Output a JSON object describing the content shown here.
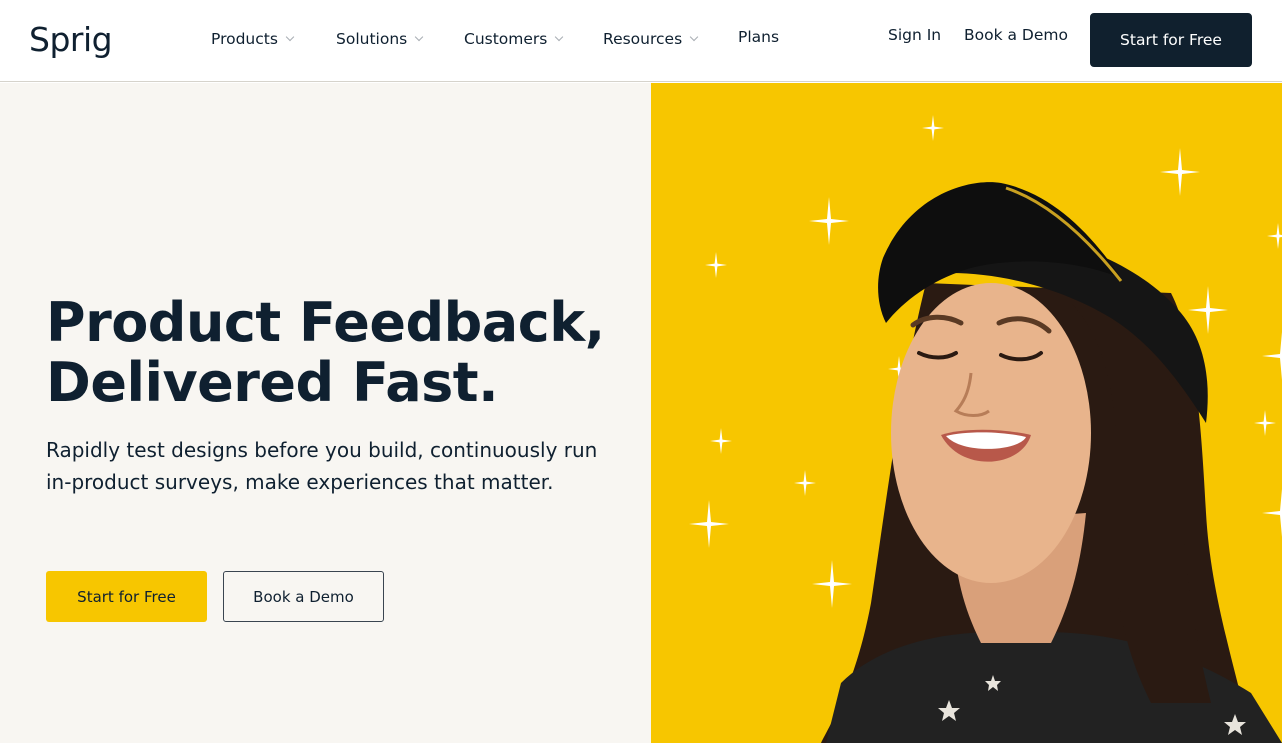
{
  "header": {
    "logo": "Sprig",
    "nav": [
      {
        "label": "Products",
        "has_dropdown": true
      },
      {
        "label": "Solutions",
        "has_dropdown": true
      },
      {
        "label": "Customers",
        "has_dropdown": true
      },
      {
        "label": "Resources",
        "has_dropdown": true
      },
      {
        "label": "Plans",
        "has_dropdown": false
      }
    ],
    "sign_in": "Sign In",
    "book_demo": "Book a Demo",
    "cta": "Start for Free"
  },
  "hero": {
    "title_line1": "Product Feedback,",
    "title_line2": "Delivered Fast.",
    "subtitle": "Rapidly test designs before you build, continuously run in-product surveys, make experiences that matter.",
    "primary_button": "Start for Free",
    "secondary_button": "Book a Demo",
    "image": {
      "description": "smiling woman in black cap on yellow background with white sparkles",
      "background_color": "#f7c600"
    }
  },
  "colors": {
    "brand_dark": "#10202e",
    "brand_yellow": "#f7c600",
    "hero_bg": "#f8f6f2"
  }
}
